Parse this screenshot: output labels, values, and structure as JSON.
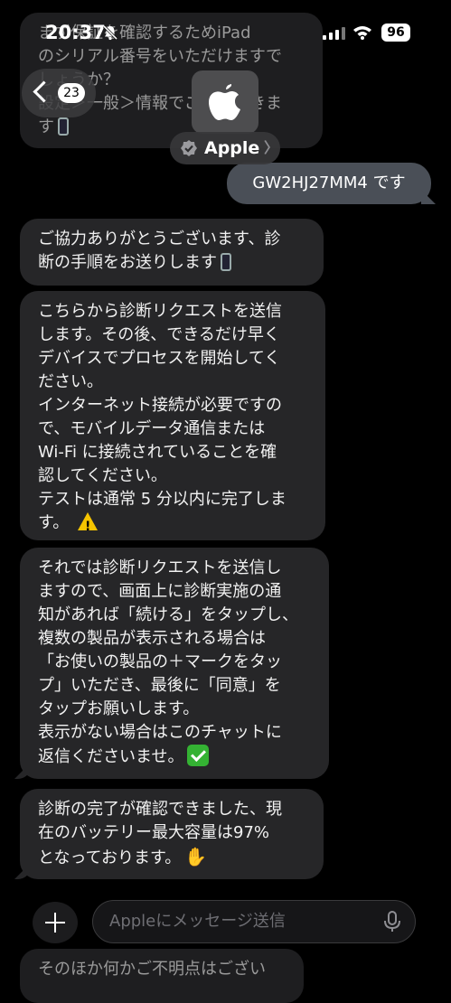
{
  "status_bar": {
    "time": "20:37",
    "battery": "96"
  },
  "header": {
    "back_count": "23",
    "contact_name": "Apple"
  },
  "messages": {
    "partial_top": "まず保証を確認するためiPad\nのシリアル番号をいただけますで\nしょうか？\n設定＞一般＞情報でご確認できま\nす",
    "outgoing_serial": "GW2HJ27MM4 です",
    "msg1": "ご協力ありがとうございます、診\n断の手順をお送りします",
    "msg2": "こちらから診断リクエストを送信\nします。その後、できるだけ早く\nデバイスでプロセスを開始してく\nださい。\nインターネット接続が必要ですの\nで、モバイルデータ通信または\nWi-Fi に接続されていることを確\n認してください。\nテストは通常 5 分以内に完了しま\nす。",
    "msg3": "それでは診断リクエストを送信し\nますので、画面上に診断実施の通\n知があれば「続ける」をタップし、\n複数の製品が表示される場合は\n「お使いの製品の＋マークをタッ\nプ」いただき、最後に「同意」を\nタップお願いします。\n表示がない場合はこのチャットに\n返信くださいませ。",
    "msg4": "診断の完了が確認できました、現\n在のバッテリー最大容量は97%\nとなっております。",
    "partial_bottom": "そのほか何かご不明点はござい"
  },
  "composer": {
    "placeholder": "Appleにメッセージ送信"
  },
  "icons": {
    "phone": "mobile-phone-icon",
    "warning": "warning-icon",
    "check": "check-mark-icon",
    "handshake": "handshake-icon"
  },
  "colors": {
    "incoming_bubble": "#262628",
    "outgoing_bubble": "#4a4f57",
    "background": "#000000"
  }
}
